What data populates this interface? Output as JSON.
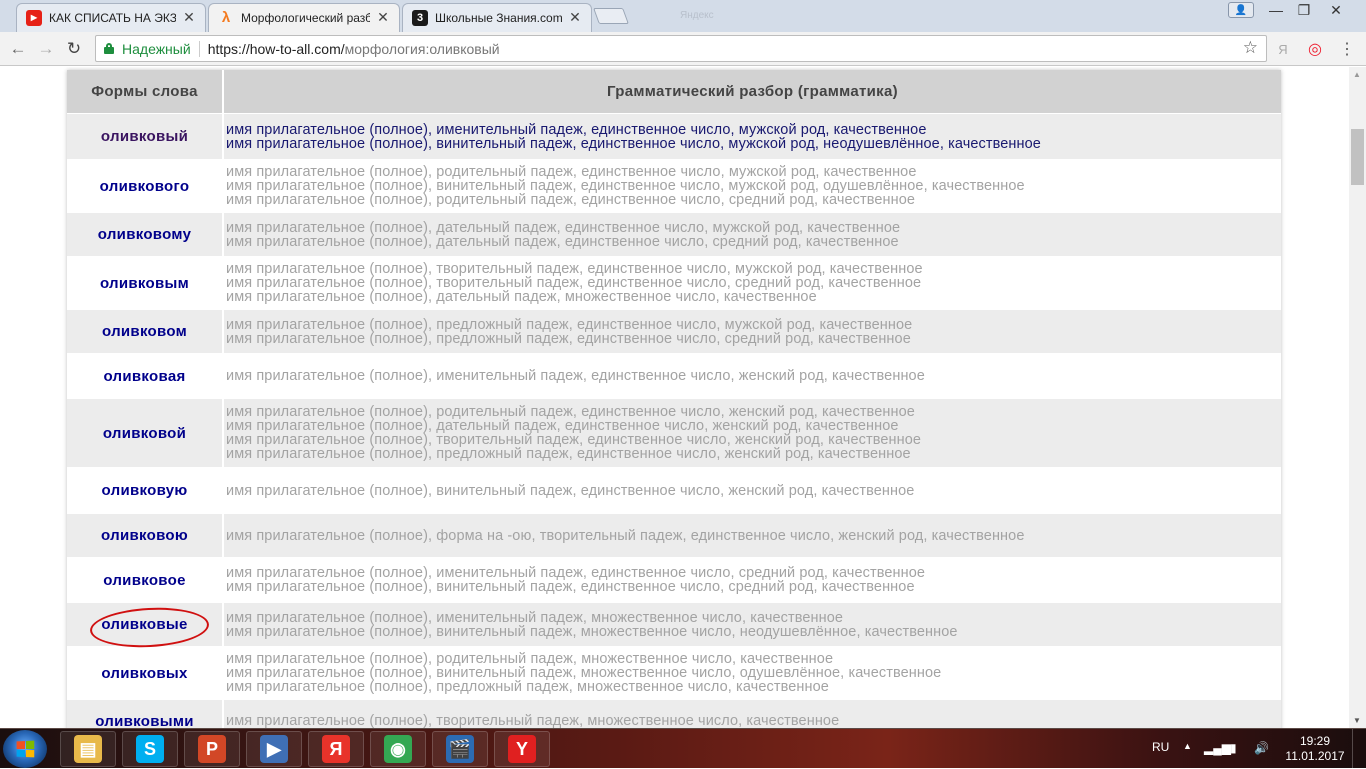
{
  "browser": {
    "tabs": [
      {
        "title": "КАК СПИСАТЬ НА ЭКЗА",
        "active": false,
        "favicon": "youtube-icon",
        "favicon_color": "#e62117"
      },
      {
        "title": "Морфологический разб",
        "active": true,
        "favicon": "lambda-icon",
        "favicon_color": "#f47b20"
      },
      {
        "title": "Школьные Знания.com",
        "active": false,
        "favicon": "znania-icon",
        "favicon_color": "#1a1a1a"
      }
    ],
    "ghost_tab_text": "Яндекс",
    "close_glyph": "✕",
    "window_controls": {
      "minimize": "—",
      "maximize": "❐",
      "close": "✕"
    },
    "nav": {
      "back": "←",
      "forward": "→",
      "reload": "↻"
    },
    "address": {
      "secure_label": "Надежный",
      "url_host": "https://how-to-all.com/",
      "url_path": "морфология:оливковый"
    },
    "star": "☆",
    "extensions": {
      "yandex": "Я",
      "opera": "◎",
      "menu": "⋮"
    }
  },
  "table": {
    "headers": {
      "forms": "Формы слова",
      "analysis": "Грамматический разбор (грамматика)"
    },
    "rows": [
      {
        "form": "оливковый",
        "current": true,
        "lines": [
          "имя прилагательное (полное), именительный падеж, единственное число, мужской род, качественное",
          "имя прилагательное (полное), винительный падеж, единственное число, мужской род, неодушевлённое, качественное"
        ]
      },
      {
        "form": "оливкового",
        "lines": [
          "имя прилагательное (полное), родительный падеж, единственное число, мужской род, качественное",
          "имя прилагательное (полное), винительный падеж, единственное число, мужской род, одушевлённое, качественное",
          "имя прилагательное (полное), родительный падеж, единственное число, средний род, качественное"
        ]
      },
      {
        "form": "оливковому",
        "lines": [
          "имя прилагательное (полное), дательный падеж, единственное число, мужской род, качественное",
          "имя прилагательное (полное), дательный падеж, единственное число, средний род, качественное"
        ]
      },
      {
        "form": "оливковым",
        "lines": [
          "имя прилагательное (полное), творительный падеж, единственное число, мужской род, качественное",
          "имя прилагательное (полное), творительный падеж, единственное число, средний род, качественное",
          "имя прилагательное (полное), дательный падеж, множественное число, качественное"
        ]
      },
      {
        "form": "оливковом",
        "lines": [
          "имя прилагательное (полное), предложный падеж, единственное число, мужской род, качественное",
          "имя прилагательное (полное), предложный падеж, единственное число, средний род, качественное"
        ]
      },
      {
        "form": "оливковая",
        "lines": [
          "имя прилагательное (полное), именительный падеж, единственное число, женский род, качественное"
        ]
      },
      {
        "form": "оливковой",
        "lines": [
          "имя прилагательное (полное), родительный падеж, единственное число, женский род, качественное",
          "имя прилагательное (полное), дательный падеж, единственное число, женский род, качественное",
          "имя прилагательное (полное), творительный падеж, единственное число, женский род, качественное",
          "имя прилагательное (полное), предложный падеж, единственное число, женский род, качественное"
        ]
      },
      {
        "form": "оливковую",
        "lines": [
          "имя прилагательное (полное), винительный падеж, единственное число, женский род, качественное"
        ]
      },
      {
        "form": "оливковою",
        "lines": [
          "имя прилагательное (полное), форма на -ою, творительный падеж, единственное число, женский род, качественное"
        ]
      },
      {
        "form": "оливковое",
        "circled": true,
        "lines": [
          "имя прилагательное (полное), именительный падеж, единственное число, средний род, качественное",
          "имя прилагательное (полное), винительный падеж, единственное число, средний род, качественное"
        ]
      },
      {
        "form": "оливковые",
        "lines": [
          "имя прилагательное (полное), именительный падеж, множественное число, качественное",
          "имя прилагательное (полное), винительный падеж, множественное число, неодушевлённое, качественное"
        ]
      },
      {
        "form": "оливковых",
        "lines": [
          "имя прилагательное (полное), родительный падеж, множественное число, качественное",
          "имя прилагательное (полное), винительный падеж, множественное число, одушевлённое, качественное",
          "имя прилагательное (полное), предложный падеж, множественное число, качественное"
        ]
      },
      {
        "form": "оливковыми",
        "lines": [
          "имя прилагательное (полное), творительный падеж, множественное число, качественное"
        ]
      }
    ]
  },
  "taskbar": {
    "apps": [
      {
        "name": "explorer",
        "glyph": "▤",
        "color": "#e8b94a"
      },
      {
        "name": "skype",
        "glyph": "S",
        "color": "#00aff0"
      },
      {
        "name": "powerpoint",
        "glyph": "P",
        "color": "#d24726"
      },
      {
        "name": "media-player",
        "glyph": "▶",
        "color": "#3f6fb5"
      },
      {
        "name": "yandex",
        "glyph": "Я",
        "color": "#e8332a"
      },
      {
        "name": "chrome",
        "glyph": "◉",
        "color": "#34a853"
      },
      {
        "name": "movie-maker",
        "glyph": "🎬",
        "color": "#2c6bb3"
      },
      {
        "name": "yandex-browser",
        "glyph": "Y",
        "color": "#e02020"
      }
    ],
    "tray": {
      "lang": "RU",
      "time": "19:29",
      "date": "11.01.2017"
    }
  }
}
